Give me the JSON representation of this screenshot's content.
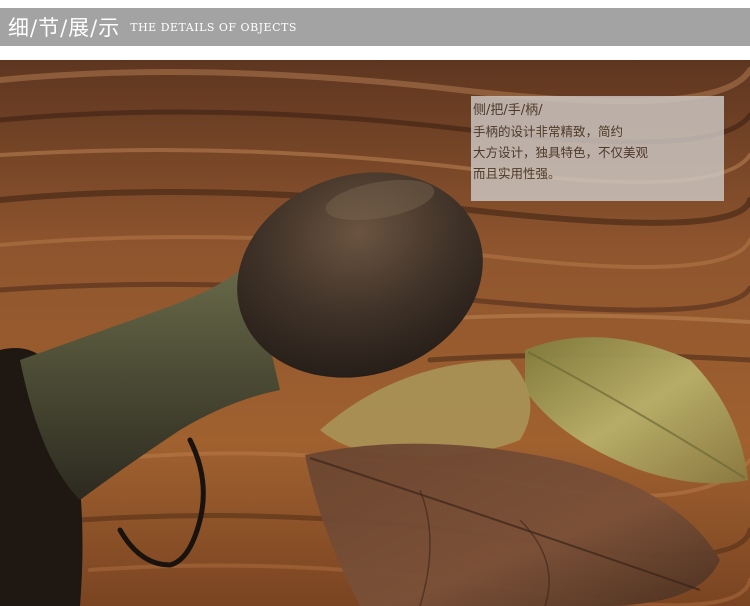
{
  "header": {
    "title_cn": "细/节/展/示",
    "title_en": "THE DETAILS OF OBJECTS"
  },
  "caption": {
    "title": "侧/把/手/柄/",
    "lines": [
      "手柄的设计非常精致，简约",
      "大方设计，独具特色，不仅美观",
      "而且实用性强。"
    ]
  },
  "photo": {
    "subject": "teapot-side-handle",
    "colors": {
      "wood": "#8a4a22",
      "handle": "#4a3a2c",
      "leaf": "#a09a52"
    }
  }
}
